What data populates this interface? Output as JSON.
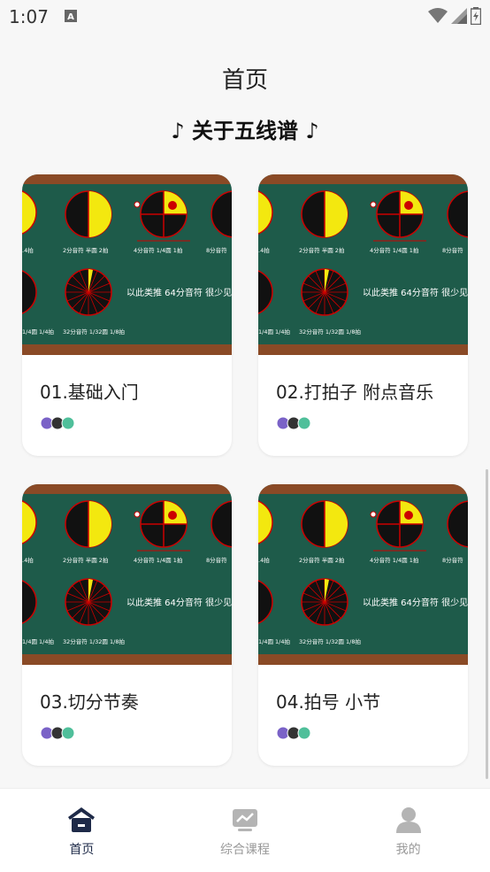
{
  "status": {
    "time": "1:07"
  },
  "header": {
    "title": "首页",
    "section_title": "♪ 关于五线谱 ♪"
  },
  "thumbnail_text": {
    "half": "2分音符  半圆  2拍",
    "quarter": "4分音符  1/4圆  1拍",
    "eighth": "8分音符",
    "left_label": ".4拍",
    "bottom_left": "1/4圆  1/4拍",
    "thirty_second": "32分音符  1/32圆  1/8拍",
    "inference": "以此类推   64分音符  很少见",
    "badge": "会"
  },
  "cards": [
    {
      "title": "01.基础入门"
    },
    {
      "title": "02.打拍子  附点音乐"
    },
    {
      "title": "03.切分节奏"
    },
    {
      "title": "04.拍号  小节"
    }
  ],
  "nav": [
    {
      "label": "首页",
      "icon": "home-icon",
      "active": true
    },
    {
      "label": "综合课程",
      "icon": "courses-icon",
      "active": false
    },
    {
      "label": "我的",
      "icon": "profile-icon",
      "active": false
    }
  ],
  "colors": {
    "board": "#1e5b4a",
    "wood": "#8a4a26",
    "pie_yellow": "#f3e80f",
    "nav_active": "#1e2a48",
    "nav_inactive": "#b4b4b4"
  }
}
